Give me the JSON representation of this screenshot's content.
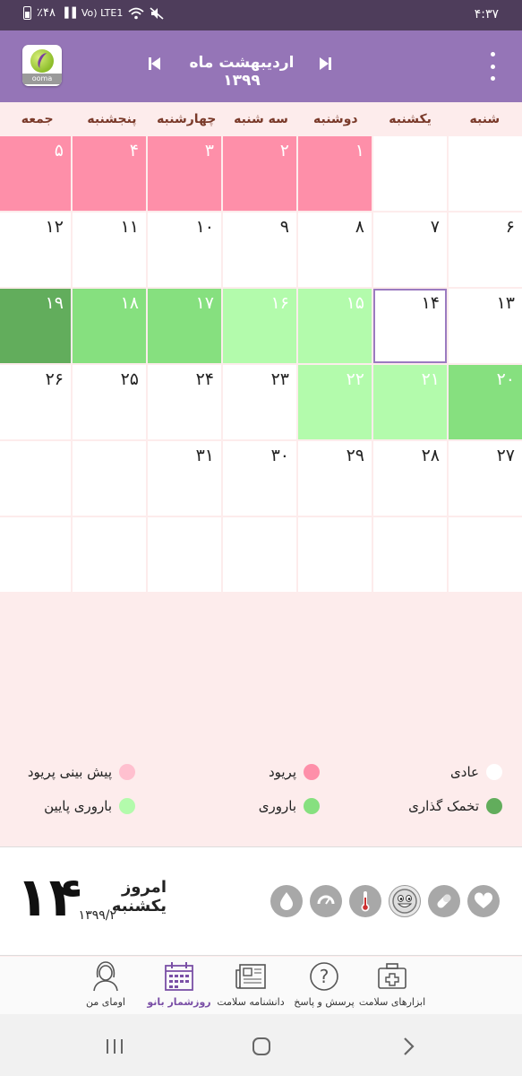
{
  "status_bar": {
    "battery": "٪۴۸",
    "network": "Vo) LTE1",
    "time": "۴:۳۷"
  },
  "header": {
    "logo_text": "ooma",
    "month_title": "اردیبهشت ماه ۱۳۹۹",
    "menu_icon": "kebab-menu-icon",
    "bg_color": "#9575b7"
  },
  "weekdays": [
    "شنبه",
    "یکشنبه",
    "دوشنبه",
    "سه شنبه",
    "چهارشنبه",
    "پنجشنبه",
    "جمعه"
  ],
  "calendar": {
    "rows": [
      [
        {
          "day": "",
          "type": "normal"
        },
        {
          "day": "",
          "type": "normal"
        },
        {
          "day": "۱",
          "type": "period"
        },
        {
          "day": "۲",
          "type": "period"
        },
        {
          "day": "۳",
          "type": "period"
        },
        {
          "day": "۴",
          "type": "period"
        },
        {
          "day": "۵",
          "type": "period"
        }
      ],
      [
        {
          "day": "۶",
          "type": "normal"
        },
        {
          "day": "۷",
          "type": "normal"
        },
        {
          "day": "۸",
          "type": "normal"
        },
        {
          "day": "۹",
          "type": "normal"
        },
        {
          "day": "۱۰",
          "type": "normal"
        },
        {
          "day": "۱۱",
          "type": "normal"
        },
        {
          "day": "۱۲",
          "type": "normal"
        }
      ],
      [
        {
          "day": "۱۳",
          "type": "normal"
        },
        {
          "day": "۱۴",
          "type": "today"
        },
        {
          "day": "۱۵",
          "type": "fertile-low"
        },
        {
          "day": "۱۶",
          "type": "fertile-low"
        },
        {
          "day": "۱۷",
          "type": "fertile-high"
        },
        {
          "day": "۱۸",
          "type": "fertile-high"
        },
        {
          "day": "۱۹",
          "type": "ovulation"
        }
      ],
      [
        {
          "day": "۲۰",
          "type": "fertile-high"
        },
        {
          "day": "۲۱",
          "type": "fertile-low"
        },
        {
          "day": "۲۲",
          "type": "fertile-low"
        },
        {
          "day": "۲۳",
          "type": "normal"
        },
        {
          "day": "۲۴",
          "type": "normal"
        },
        {
          "day": "۲۵",
          "type": "normal"
        },
        {
          "day": "۲۶",
          "type": "normal"
        }
      ],
      [
        {
          "day": "۲۷",
          "type": "normal"
        },
        {
          "day": "۲۸",
          "type": "normal"
        },
        {
          "day": "۲۹",
          "type": "normal"
        },
        {
          "day": "۳۰",
          "type": "normal"
        },
        {
          "day": "۳۱",
          "type": "normal"
        },
        {
          "day": "",
          "type": "normal"
        },
        {
          "day": "",
          "type": "normal"
        }
      ],
      [
        {
          "day": "",
          "type": "normal"
        },
        {
          "day": "",
          "type": "normal"
        },
        {
          "day": "",
          "type": "normal"
        },
        {
          "day": "",
          "type": "normal"
        },
        {
          "day": "",
          "type": "normal"
        },
        {
          "day": "",
          "type": "normal"
        },
        {
          "day": "",
          "type": "normal"
        }
      ]
    ]
  },
  "legend": {
    "normal": {
      "label": "عادی",
      "color": "#ffffff"
    },
    "period": {
      "label": "پریود",
      "color": "#fe8fa9"
    },
    "period_prediction": {
      "label": "پیش بینی پریود",
      "color": "#ffc0cf"
    },
    "ovulation": {
      "label": "تخمک گذاری",
      "color": "#62ad5c"
    },
    "fertile": {
      "label": "باروری",
      "color": "#86e07f"
    },
    "fertile_low": {
      "label": "باروری پایین",
      "color": "#b3fbac"
    }
  },
  "today": {
    "label": "امروز یکشنبه",
    "day": "۱۴",
    "date": "۱۳۹۹/۲",
    "tools": [
      "heart-icon",
      "pill-icon",
      "mood-face-icon",
      "thermometer-icon",
      "weight-scale-icon",
      "water-drop-icon"
    ]
  },
  "bottom_nav": {
    "health_tools": "ابزارهای سلامت",
    "qa": "پرسش و پاسخ",
    "encyclopedia": "دانشنامه سلامت",
    "calendar": "روزشمار بانو",
    "my_ooma": "اومای من"
  }
}
